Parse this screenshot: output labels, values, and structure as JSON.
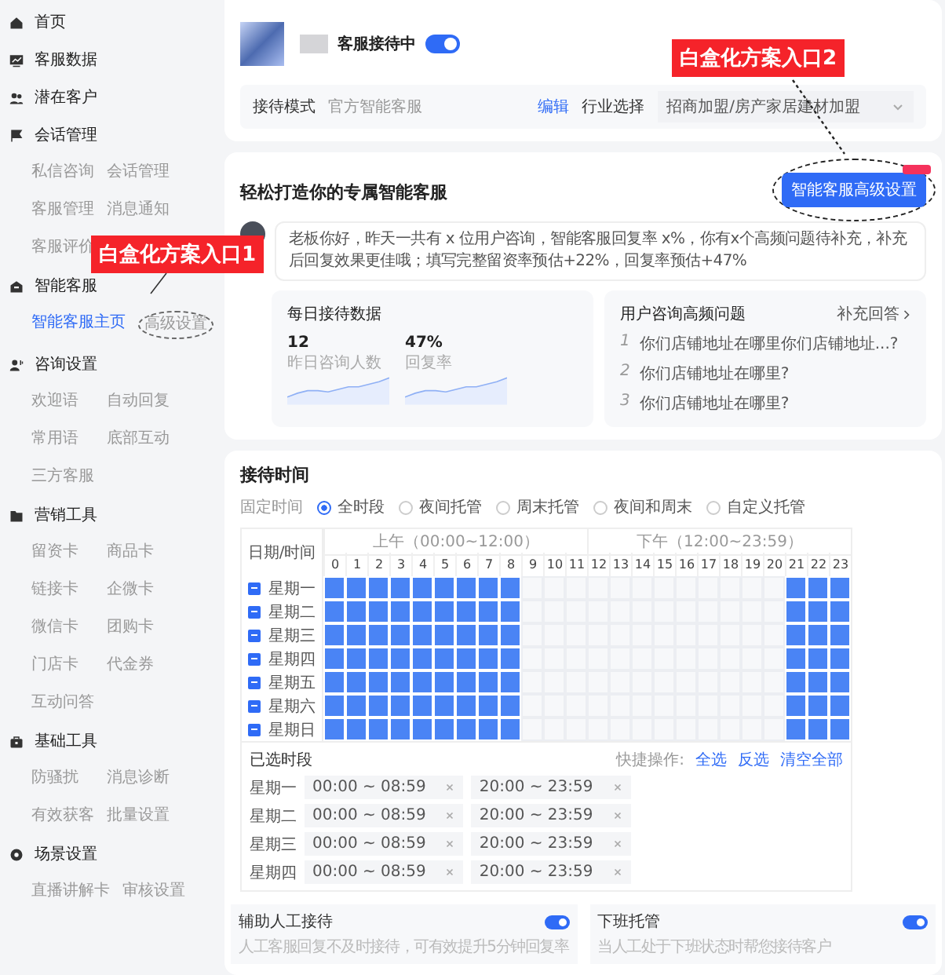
{
  "sidebar": {
    "items": [
      {
        "label": "首页",
        "selected": false
      },
      {
        "label": "客服数据",
        "selected": false
      },
      {
        "label": "潜在客户",
        "selected": false
      },
      {
        "label": "会话管理",
        "selected": false,
        "children": [
          {
            "label": "私信咨询",
            "selected": false
          },
          {
            "label": "会话管理",
            "selected": false
          },
          {
            "label": "客服管理",
            "selected": false
          },
          {
            "label": "消息通知",
            "selected": false
          },
          {
            "label": "客服评价",
            "selected": false
          }
        ]
      },
      {
        "label": "智能客服",
        "selected": false,
        "children": [
          {
            "label": "智能客服主页",
            "selected": true
          },
          {
            "label": "高级设置",
            "selected": false,
            "annotated": true
          }
        ]
      },
      {
        "label": "咨询设置",
        "selected": false,
        "children": [
          {
            "label": "欢迎语",
            "selected": false
          },
          {
            "label": "自动回复",
            "selected": false
          },
          {
            "label": "常用语",
            "selected": false
          },
          {
            "label": "底部互动",
            "selected": false
          },
          {
            "label": "三方客服",
            "selected": false
          }
        ]
      },
      {
        "label": "营销工具",
        "selected": false,
        "children": [
          {
            "label": "留资卡",
            "selected": false
          },
          {
            "label": "商品卡",
            "selected": false
          },
          {
            "label": "链接卡",
            "selected": false
          },
          {
            "label": "企微卡",
            "selected": false
          },
          {
            "label": "微信卡",
            "selected": false
          },
          {
            "label": "团购卡",
            "selected": false
          },
          {
            "label": "门店卡",
            "selected": false
          },
          {
            "label": "代金券",
            "selected": false
          },
          {
            "label": "互动问答",
            "selected": false
          }
        ]
      },
      {
        "label": "基础工具",
        "selected": false,
        "children": [
          {
            "label": "防骚扰",
            "selected": false
          },
          {
            "label": "消息诊断",
            "selected": false
          },
          {
            "label": "有效获客",
            "selected": false
          },
          {
            "label": "批量设置",
            "selected": false
          }
        ]
      },
      {
        "label": "场景设置",
        "selected": false,
        "children": [
          {
            "label": "直播讲解卡",
            "selected": false
          },
          {
            "label": "审核设置",
            "selected": false
          }
        ]
      }
    ]
  },
  "status": {
    "label": "客服接待中",
    "on": true
  },
  "mode": {
    "label": "接待模式",
    "value": "官方智能客服",
    "edit": "编辑",
    "industry_label": "行业选择",
    "industry_value": "招商加盟/房产家居建材加盟"
  },
  "intro": {
    "title": "轻松打造你的专属智能客服",
    "button": "智能客服高级设置",
    "message": "老板你好，昨天一共有 x 位用户咨询，智能客服回复率 x%，你有x个高频问题待补充，补充后回复效果更佳哦；填写完整留资率预估+22%，回复率预估+47%"
  },
  "daily": {
    "title": "每日接待数据",
    "stats": [
      {
        "value": "12",
        "label": "昨日咨询人数"
      },
      {
        "value": "47%",
        "label": "回复率"
      }
    ]
  },
  "faq": {
    "title": "用户咨询高频问题",
    "link": "补充回答",
    "items": [
      {
        "num": "1",
        "text": "你们店铺地址在哪里你们店铺地址...?"
      },
      {
        "num": "2",
        "text": "你们店铺地址在哪里?"
      },
      {
        "num": "3",
        "text": "你们店铺地址在哪里?"
      }
    ]
  },
  "schedule": {
    "title": "接待时间",
    "mode_label": "固定时间",
    "modes": [
      {
        "label": "全时段",
        "selected": true
      },
      {
        "label": "夜间托管",
        "selected": false
      },
      {
        "label": "周末托管",
        "selected": false
      },
      {
        "label": "夜间和周末",
        "selected": false
      },
      {
        "label": "自定义托管",
        "selected": false
      }
    ],
    "corner": "日期/时间",
    "am": "上午（00:00~12:00）",
    "pm": "下午（12:00~23:59）",
    "hours": [
      "0",
      "1",
      "2",
      "3",
      "4",
      "5",
      "6",
      "7",
      "8",
      "9",
      "10",
      "11",
      "12",
      "13",
      "14",
      "15",
      "16",
      "17",
      "18",
      "19",
      "20",
      "21",
      "22",
      "23"
    ],
    "days": [
      {
        "label": "星期一",
        "partial": true,
        "cells": [
          true,
          true,
          true,
          true,
          true,
          true,
          true,
          true,
          true,
          false,
          false,
          false,
          false,
          false,
          false,
          false,
          false,
          false,
          false,
          false,
          false,
          true,
          true,
          true
        ]
      },
      {
        "label": "星期二",
        "partial": true,
        "cells": [
          true,
          true,
          true,
          true,
          true,
          true,
          true,
          true,
          true,
          false,
          false,
          false,
          false,
          false,
          false,
          false,
          false,
          false,
          false,
          false,
          false,
          true,
          true,
          true
        ]
      },
      {
        "label": "星期三",
        "partial": true,
        "cells": [
          true,
          true,
          true,
          true,
          true,
          true,
          true,
          true,
          true,
          false,
          false,
          false,
          false,
          false,
          false,
          false,
          false,
          false,
          false,
          false,
          false,
          true,
          true,
          true
        ]
      },
      {
        "label": "星期四",
        "partial": true,
        "cells": [
          true,
          true,
          true,
          true,
          true,
          true,
          true,
          true,
          true,
          false,
          false,
          false,
          false,
          false,
          false,
          false,
          false,
          false,
          false,
          false,
          false,
          true,
          true,
          true
        ]
      },
      {
        "label": "星期五",
        "partial": true,
        "cells": [
          true,
          true,
          true,
          true,
          true,
          true,
          true,
          true,
          true,
          false,
          false,
          false,
          false,
          false,
          false,
          false,
          false,
          false,
          false,
          false,
          false,
          true,
          true,
          true
        ]
      },
      {
        "label": "星期六",
        "partial": true,
        "cells": [
          true,
          true,
          true,
          true,
          true,
          true,
          true,
          true,
          true,
          false,
          false,
          false,
          false,
          false,
          false,
          false,
          false,
          false,
          false,
          false,
          false,
          true,
          true,
          true
        ]
      },
      {
        "label": "星期日",
        "partial": true,
        "cells": [
          true,
          true,
          true,
          true,
          true,
          true,
          true,
          true,
          true,
          false,
          false,
          false,
          false,
          false,
          false,
          false,
          false,
          false,
          false,
          false,
          false,
          true,
          true,
          true
        ]
      }
    ],
    "selected_title": "已选时段",
    "quick_label": "快捷操作:",
    "quick_actions": [
      "全选",
      "反选",
      "清空全部"
    ],
    "periods": [
      {
        "day": "星期一",
        "ranges": [
          "00:00 ~ 08:59",
          "20:00 ~ 23:59"
        ]
      },
      {
        "day": "星期二",
        "ranges": [
          "00:00 ~ 08:59",
          "20:00 ~ 23:59"
        ]
      },
      {
        "day": "星期三",
        "ranges": [
          "00:00 ~ 08:59",
          "20:00 ~ 23:59"
        ]
      },
      {
        "day": "星期四",
        "ranges": [
          "00:00 ~ 08:59",
          "20:00 ~ 23:59"
        ]
      }
    ]
  },
  "features": [
    {
      "title": "辅助人工接待",
      "desc": "人工客服回复不及时接待，可有效提升5分钟回复率",
      "on": true
    },
    {
      "title": "下班托管",
      "desc": "当人工处于下班状态时帮您接待客户",
      "on": true
    }
  ],
  "annotations": [
    {
      "text": "白盒化方案入口1"
    },
    {
      "text": "白盒化方案入口2"
    }
  ]
}
